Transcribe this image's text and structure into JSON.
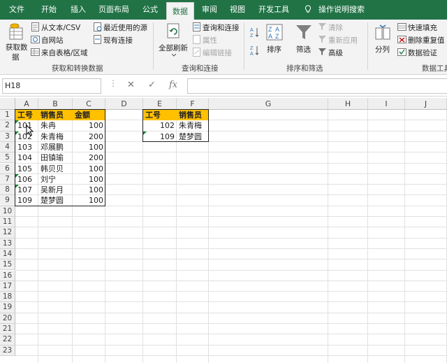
{
  "tabs": [
    "文件",
    "开始",
    "插入",
    "页面布局",
    "公式",
    "数据",
    "审阅",
    "视图",
    "开发工具"
  ],
  "active_tab": "数据",
  "tell_me": "操作说明搜索",
  "ribbon": {
    "get_data_1": "获取数",
    "get_data_2": "据",
    "from_text": "从文本/CSV",
    "from_web": "自网站",
    "from_table": "来自表格/区域",
    "recent_sources": "最近使用的源",
    "existing_conn": "现有连接",
    "group1": "获取和转换数据",
    "refresh_all": "全部刷新",
    "queries_conn": "查询和连接",
    "properties": "属性",
    "edit_links": "编辑链接",
    "group2": "查询和连接",
    "sort": "排序",
    "filter": "筛选",
    "clear": "清除",
    "reapply": "重新应用",
    "advanced": "高级",
    "group3": "排序和筛选",
    "split": "分列",
    "flash_fill": "快速填充",
    "remove_dup": "删除重复值",
    "validation": "数据验证",
    "group4": "数据工具"
  },
  "formula_bar": {
    "name_box": "H18",
    "cancel": "✕",
    "enter": "✓",
    "fx": "fx",
    "formula": ""
  },
  "columns": [
    "A",
    "B",
    "C",
    "D",
    "E",
    "F",
    "G",
    "H",
    "I",
    "J"
  ],
  "rows": [
    "1",
    "2",
    "3",
    "4",
    "5",
    "6",
    "7",
    "8",
    "9",
    "10",
    "11",
    "12",
    "13",
    "14",
    "15",
    "16",
    "17",
    "18",
    "19",
    "20",
    "21",
    "22",
    "23"
  ],
  "table1": {
    "headers": [
      "工号",
      "销售员",
      "金额"
    ],
    "rows": [
      [
        "101",
        "朱冉",
        "100"
      ],
      [
        "102",
        "朱青梅",
        "200"
      ],
      [
        "103",
        "邓展鹏",
        "100"
      ],
      [
        "104",
        "田镇瑜",
        "200"
      ],
      [
        "105",
        "韩贝贝",
        "100"
      ],
      [
        "106",
        "刘宁",
        "100"
      ],
      [
        "107",
        "吴新月",
        "100"
      ],
      [
        "109",
        "楚梦圆",
        "100"
      ]
    ]
  },
  "table2": {
    "headers": [
      "工号",
      "销售员"
    ],
    "rows": [
      [
        "102",
        "朱青梅"
      ],
      [
        "109",
        "楚梦圆"
      ]
    ]
  },
  "colors": {
    "excel_green": "#217346",
    "header_fill": "#ffc000",
    "error_marker": "#1e7e34"
  }
}
